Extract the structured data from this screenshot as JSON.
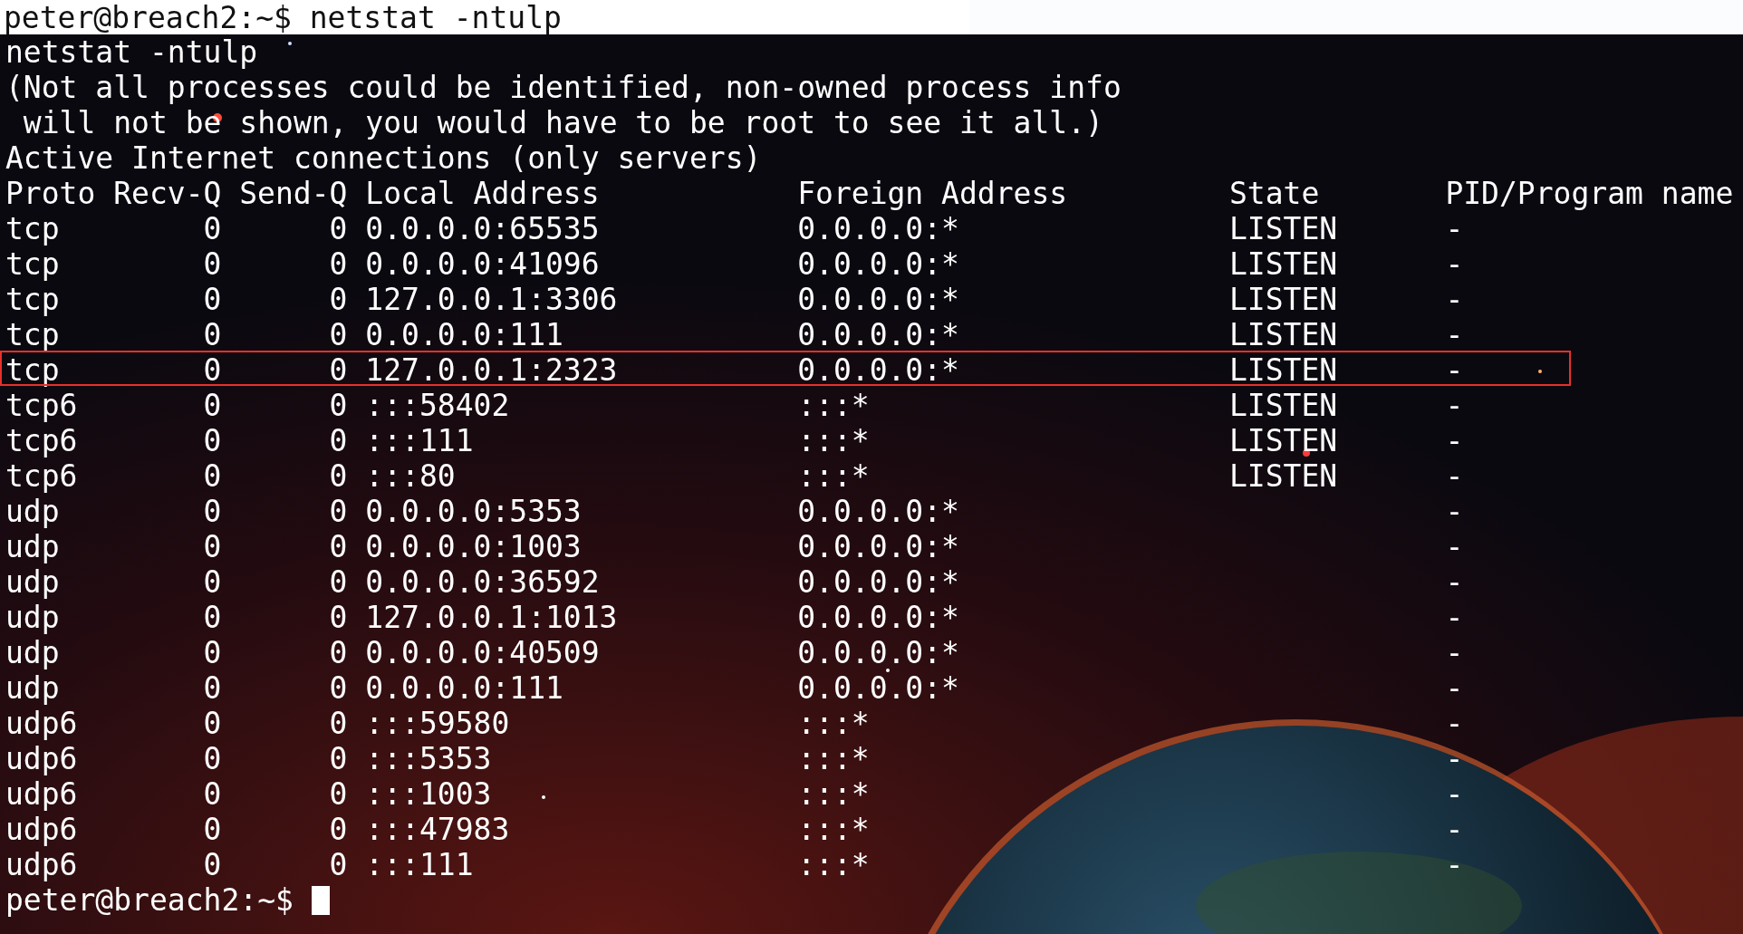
{
  "title_bar": {
    "prompt": "peter@breach2:~$",
    "command": "netstat -ntulp"
  },
  "output": {
    "echo": "netstat -ntulp",
    "notice_lines": [
      "(Not all processes could be identified, non-owned process info",
      "will not be shown, you would have to be root to see it all.)"
    ],
    "heading": "Active Internet connections (only servers)"
  },
  "table": {
    "columns": [
      "Proto",
      "Recv-Q",
      "Send-Q",
      "Local Address",
      "Foreign Address",
      "State",
      "PID/Program name"
    ],
    "rows": [
      {
        "proto": "tcp",
        "recv_q": "0",
        "send_q": "0",
        "local": "0.0.0.0:65535",
        "foreign": "0.0.0.0:*",
        "state": "LISTEN",
        "pid": "-",
        "highlighted": false
      },
      {
        "proto": "tcp",
        "recv_q": "0",
        "send_q": "0",
        "local": "0.0.0.0:41096",
        "foreign": "0.0.0.0:*",
        "state": "LISTEN",
        "pid": "-",
        "highlighted": false
      },
      {
        "proto": "tcp",
        "recv_q": "0",
        "send_q": "0",
        "local": "127.0.0.1:3306",
        "foreign": "0.0.0.0:*",
        "state": "LISTEN",
        "pid": "-",
        "highlighted": false
      },
      {
        "proto": "tcp",
        "recv_q": "0",
        "send_q": "0",
        "local": "0.0.0.0:111",
        "foreign": "0.0.0.0:*",
        "state": "LISTEN",
        "pid": "-",
        "highlighted": false
      },
      {
        "proto": "tcp",
        "recv_q": "0",
        "send_q": "0",
        "local": "127.0.0.1:2323",
        "foreign": "0.0.0.0:*",
        "state": "LISTEN",
        "pid": "-",
        "highlighted": true
      },
      {
        "proto": "tcp6",
        "recv_q": "0",
        "send_q": "0",
        "local": ":::58402",
        "foreign": ":::*",
        "state": "LISTEN",
        "pid": "-",
        "highlighted": false
      },
      {
        "proto": "tcp6",
        "recv_q": "0",
        "send_q": "0",
        "local": ":::111",
        "foreign": ":::*",
        "state": "LISTEN",
        "pid": "-",
        "highlighted": false
      },
      {
        "proto": "tcp6",
        "recv_q": "0",
        "send_q": "0",
        "local": ":::80",
        "foreign": ":::*",
        "state": "LISTEN",
        "pid": "-",
        "highlighted": false
      },
      {
        "proto": "udp",
        "recv_q": "0",
        "send_q": "0",
        "local": "0.0.0.0:5353",
        "foreign": "0.0.0.0:*",
        "pid": "-",
        "highlighted": false
      },
      {
        "proto": "udp",
        "recv_q": "0",
        "send_q": "0",
        "local": "0.0.0.0:1003",
        "foreign": "0.0.0.0:*",
        "pid": "-",
        "highlighted": false
      },
      {
        "proto": "udp",
        "recv_q": "0",
        "send_q": "0",
        "local": "0.0.0.0:36592",
        "foreign": "0.0.0.0:*",
        "pid": "-",
        "highlighted": false
      },
      {
        "proto": "udp",
        "recv_q": "0",
        "send_q": "0",
        "local": "127.0.0.1:1013",
        "foreign": "0.0.0.0:*",
        "pid": "-",
        "highlighted": false
      },
      {
        "proto": "udp",
        "recv_q": "0",
        "send_q": "0",
        "local": "0.0.0.0:40509",
        "foreign": "0.0.0.0:*",
        "pid": "-",
        "highlighted": false
      },
      {
        "proto": "udp",
        "recv_q": "0",
        "send_q": "0",
        "local": "0.0.0.0:111",
        "foreign": "0.0.0.0:*",
        "pid": "-",
        "highlighted": false
      },
      {
        "proto": "udp6",
        "recv_q": "0",
        "send_q": "0",
        "local": ":::59580",
        "foreign": ":::*",
        "pid": "-",
        "highlighted": false
      },
      {
        "proto": "udp6",
        "recv_q": "0",
        "send_q": "0",
        "local": ":::5353",
        "foreign": ":::*",
        "pid": "-",
        "highlighted": false
      },
      {
        "proto": "udp6",
        "recv_q": "0",
        "send_q": "0",
        "local": ":::1003",
        "foreign": ":::*",
        "pid": "-",
        "highlighted": false
      },
      {
        "proto": "udp6",
        "recv_q": "0",
        "send_q": "0",
        "local": ":::47983",
        "foreign": ":::*",
        "pid": "-",
        "highlighted": false
      },
      {
        "proto": "udp6",
        "recv_q": "0",
        "send_q": "0",
        "local": ":::111",
        "foreign": ":::*",
        "pid": "-",
        "highlighted": false
      }
    ]
  },
  "prompt": {
    "text": "peter@breach2:~$",
    "cursor": true
  }
}
